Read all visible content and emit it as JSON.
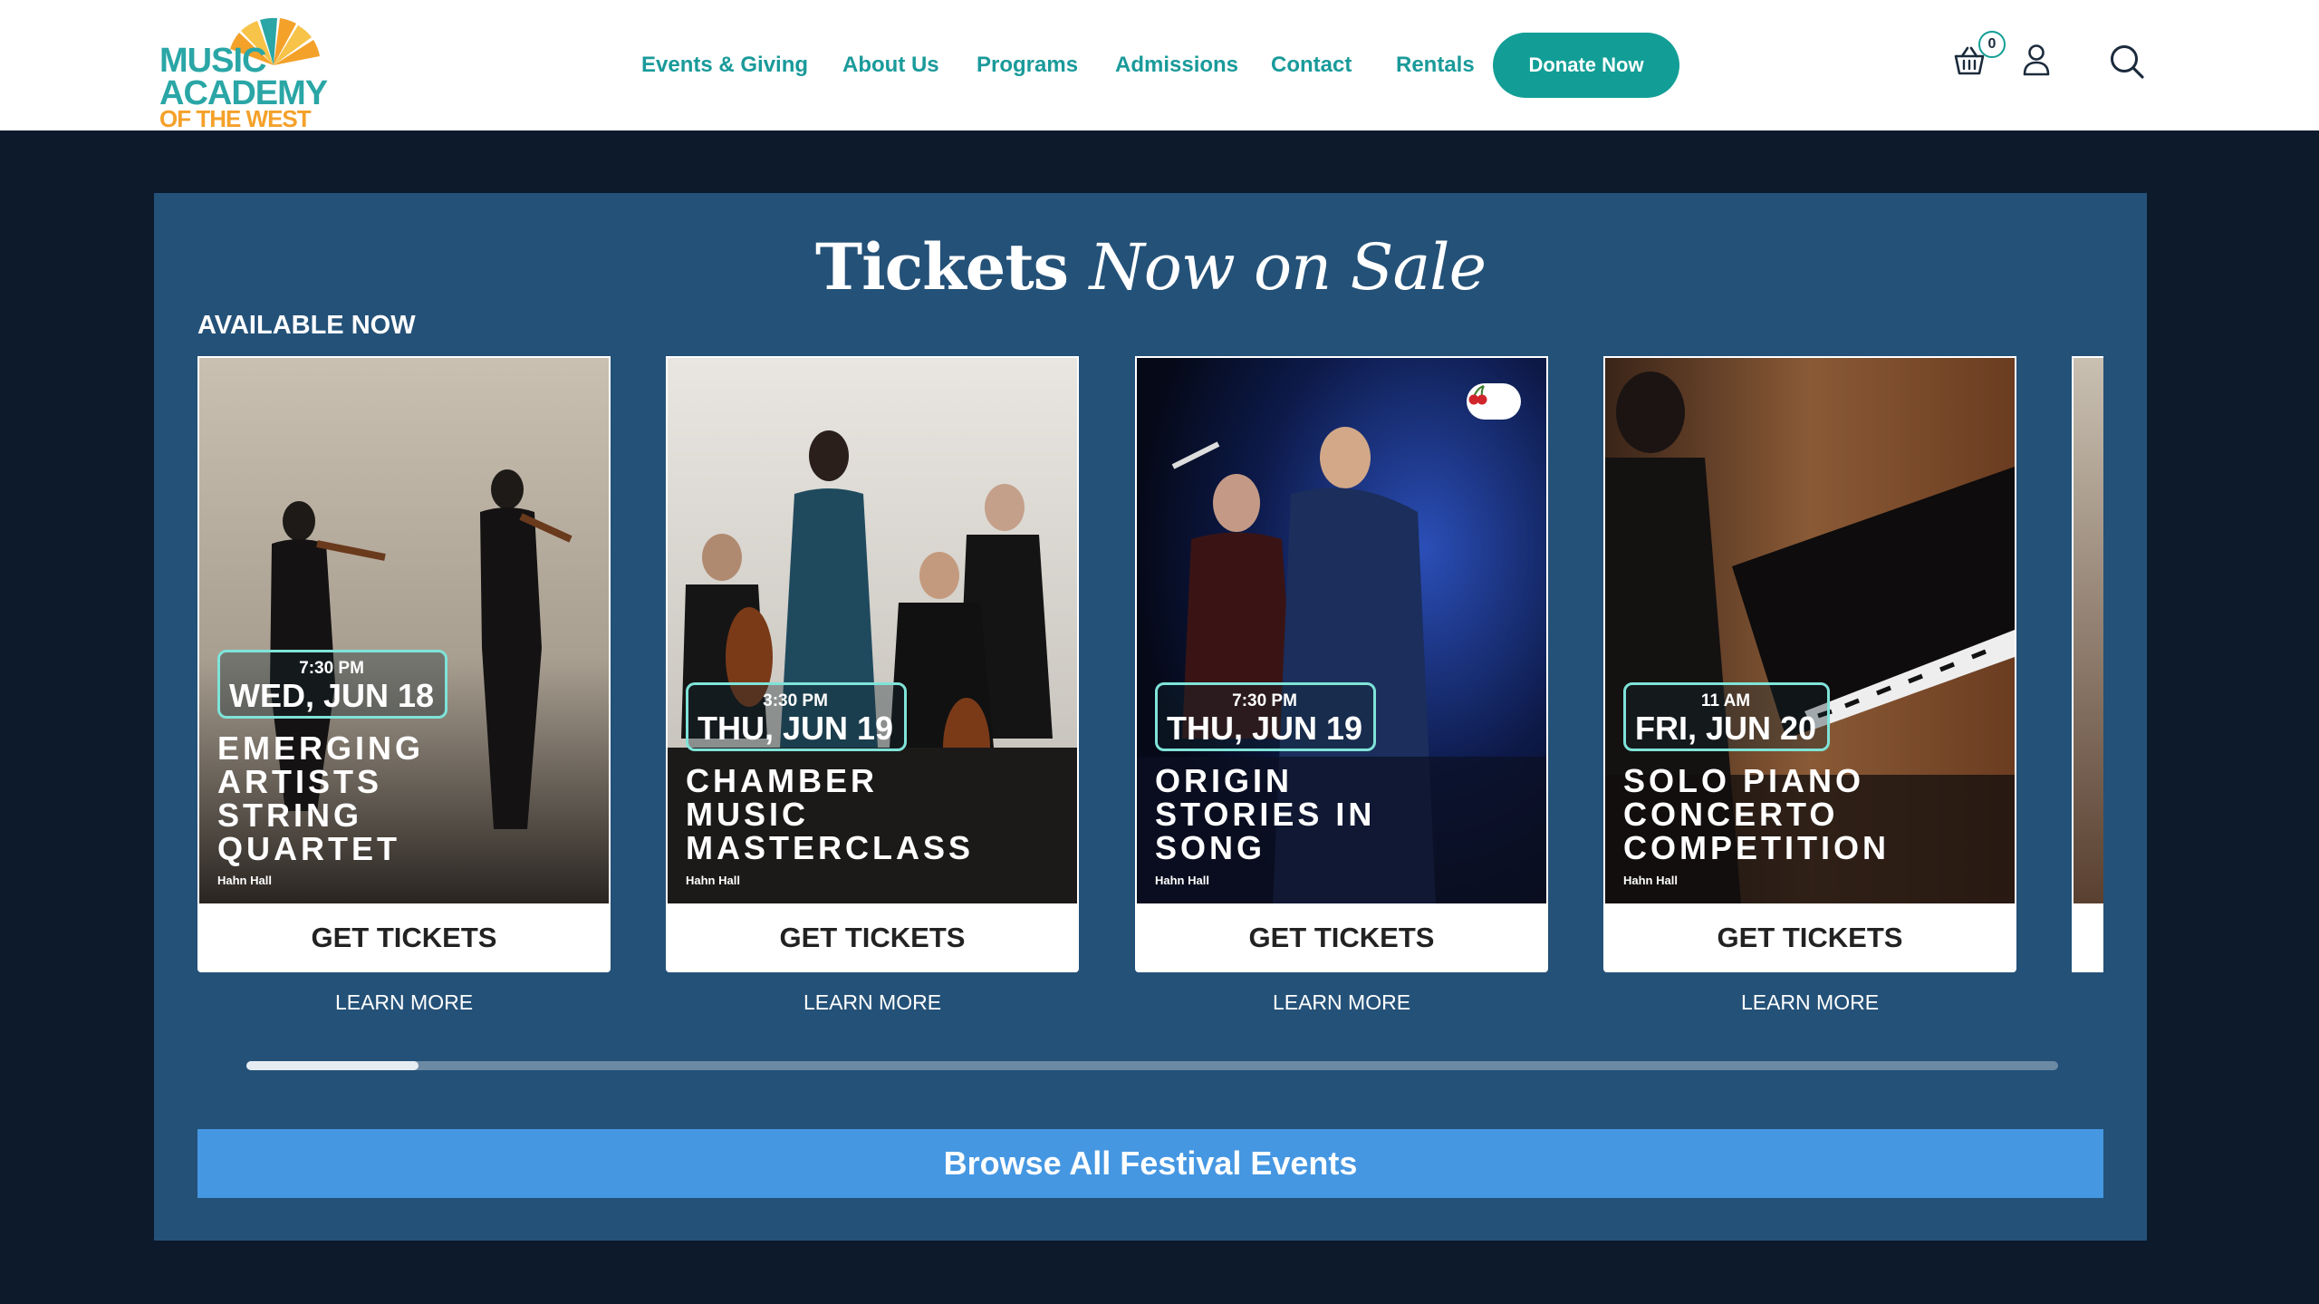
{
  "header": {
    "logo": {
      "line1": "MUSIC",
      "line2": "ACADEMY",
      "line3": "OF THE WEST"
    },
    "nav": [
      {
        "label": "Events & Giving"
      },
      {
        "label": "About Us"
      },
      {
        "label": "Programs"
      },
      {
        "label": "Admissions"
      },
      {
        "label": "Contact"
      },
      {
        "label": "Rentals"
      }
    ],
    "donate_label": "Donate Now",
    "cart_count": "0",
    "icons": [
      "basket-icon",
      "user-icon",
      "search-icon"
    ]
  },
  "section": {
    "title_plain": "Tickets ",
    "title_italic": "Now on Sale",
    "available_label": "AVAILABLE NOW"
  },
  "events": [
    {
      "time": "7:30 PM",
      "day": "WED, JUN 18",
      "title": "EMERGING ARTISTS STRING QUARTET",
      "venue": "Hahn Hall",
      "cta": "GET TICKETS",
      "learn": "LEARN MORE"
    },
    {
      "time": "3:30 PM",
      "day": "THU, JUN 19",
      "title": "CHAMBER MUSIC MASTERCLASS",
      "venue": "Hahn Hall",
      "cta": "GET TICKETS",
      "learn": "LEARN MORE"
    },
    {
      "time": "7:30 PM",
      "day": "THU, JUN 19",
      "title": "ORIGIN STORIES IN SONG",
      "venue": "Hahn Hall",
      "cta": "GET TICKETS",
      "learn": "LEARN MORE",
      "badge": "cherry-icon"
    },
    {
      "time": "11 AM",
      "day": "FRI, JUN 20",
      "title": "SOLO PIANO CONCERTO COMPETITION",
      "venue": "Hahn Hall",
      "cta": "GET TICKETS",
      "learn": "LEARN MORE"
    }
  ],
  "carousel": {
    "scroll_fraction": 0.095
  },
  "browse_label": "Browse All Festival Events",
  "colors": {
    "teal": "#129e96",
    "panel": "#245178",
    "page_bg": "#0c1a2c",
    "browse": "#4597e2",
    "logo_orange": "#f4a12a"
  }
}
